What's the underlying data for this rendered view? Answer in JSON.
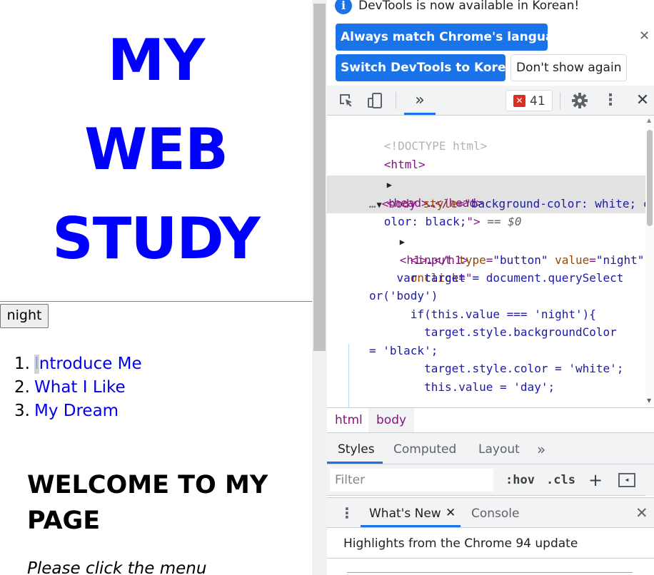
{
  "page": {
    "title_lines": [
      "MY",
      "WEB",
      "STUDY"
    ],
    "night_button": "night",
    "menu": [
      {
        "num": "1.",
        "label": "Introduce Me"
      },
      {
        "num": "2.",
        "label": "What I Like"
      },
      {
        "num": "3.",
        "label": "My Dream"
      }
    ],
    "welcome_heading": "WELCOME TO MY PAGE",
    "intro_text": "Please click the menu"
  },
  "devtools": {
    "infobar": {
      "message": "DevTools is now available in Korean!",
      "btn_match": "Always match Chrome's language",
      "btn_switch": "Switch DevTools to Korean",
      "btn_dont": "Don't show again",
      "info_icon": "i",
      "close": "✕"
    },
    "toolbar": {
      "more_tabs": "»",
      "error_count": "41",
      "error_icon": "✕",
      "close": "✕"
    },
    "elements": {
      "doctype": "<!DOCTYPE html>",
      "html_open": "<html>",
      "head_collapsed": "<head>…</head>",
      "body_tag_open": "<body ",
      "body_attr": "style",
      "body_eq": "=\"",
      "body_val_1": "background-color: white; c",
      "body_val_2": "olor: black;",
      "body_close_quote": "\">",
      "body_dollar": " == $0",
      "dots": "…",
      "h1_collapsed": "<h1>…</h1>",
      "input_tag": "<input ",
      "attr_type": "type",
      "val_type": "\"button\"",
      "attr_value": "value",
      "val_value": "\"night\"",
      "attr_onclick": "onclick",
      "onclick_open": "=\"",
      "js_1": "    var target = document.querySelect",
      "js_2": "or('body')",
      "js_3": "      if(this.value === 'night'){",
      "js_4": "        target.style.backgroundColor",
      "js_5": "= 'black';",
      "js_6": "        target.style.color = 'white';",
      "js_7": "        this.value = 'day';"
    },
    "breadcrumbs": [
      "html",
      "body"
    ],
    "styles_tabs": {
      "styles": "Styles",
      "computed": "Computed",
      "layout": "Layout",
      "more": "»"
    },
    "filter": {
      "placeholder": "Filter",
      "hov": ":hov",
      "cls": ".cls",
      "plus": "+"
    },
    "drawer": {
      "kebab": "⋮",
      "whats_new": "What's New",
      "tab_close": "✕",
      "console": "Console",
      "close": "✕"
    },
    "whats_new_heading": "Highlights from the Chrome 94 update"
  }
}
